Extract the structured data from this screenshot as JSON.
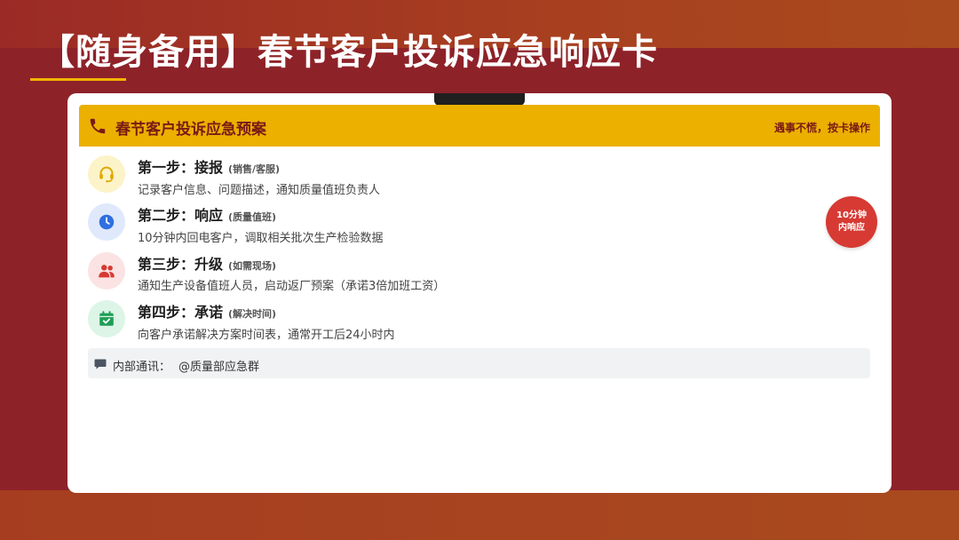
{
  "page": {
    "title": "【随身备用】春节客户投诉应急响应卡"
  },
  "card": {
    "header_title": "春节客户投诉应急预案",
    "header_note": "遇事不慌，按卡操作",
    "steps": [
      {
        "title": "第一步：接报",
        "tag": "(销售/客服)",
        "desc": "记录客户信息、问题描述，通知质量值班负责人",
        "icon": "headset-icon",
        "color": "#e0a800",
        "bg": "#fdf3c8"
      },
      {
        "title": "第二步：响应",
        "tag": "(质量值班)",
        "desc": "10分钟内回电客户，调取相关批次生产检验数据",
        "icon": "clock-icon",
        "color": "#2f6fe0",
        "bg": "#dfe9fb"
      },
      {
        "title": "第三步：升级",
        "tag": "(如需现场)",
        "desc": "通知生产设备值班人员，启动返厂预案（承诺3倍加班工资）",
        "icon": "users-icon",
        "color": "#d63a33",
        "bg": "#fbe3e3"
      },
      {
        "title": "第四步：承诺",
        "tag": "(解决时间)",
        "desc": "向客户承诺解决方案时间表，通常开工后24小时内",
        "icon": "calendar-check-icon",
        "color": "#1f9d55",
        "bg": "#dcf5e6"
      }
    ],
    "badge": {
      "line1": "10分钟",
      "line2": "内响应"
    },
    "comm": {
      "label": "内部通讯：",
      "value": "@质量部应急群",
      "icon": "chat-bubble-icon"
    }
  },
  "colors": {
    "background": "#8e2229",
    "accent_yellow": "#ebb000",
    "badge_red": "#d63a33",
    "header_text": "#7a1a15"
  }
}
